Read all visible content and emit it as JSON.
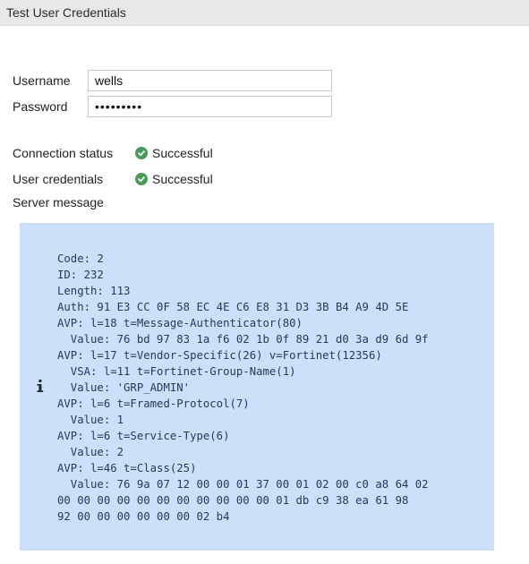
{
  "header": {
    "title": "Test User Credentials"
  },
  "form": {
    "username_label": "Username",
    "username_value": "wells",
    "password_label": "Password",
    "password_value": "•••••••••"
  },
  "status": {
    "connection_label": "Connection status",
    "connection_value": "Successful",
    "credentials_label": "User credentials",
    "credentials_value": "Successful",
    "server_message_label": "Server message"
  },
  "server_message": {
    "text": "Code: 2\nID: 232\nLength: 113\nAuth: 91 E3 CC 0F 58 EC 4E C6 E8 31 D3 3B B4 A9 4D 5E\nAVP: l=18 t=Message-Authenticator(80)\n  Value: 76 bd 97 83 1a f6 02 1b 0f 89 21 d0 3a d9 6d 9f\nAVP: l=17 t=Vendor-Specific(26) v=Fortinet(12356)\n  VSA: l=11 t=Fortinet-Group-Name(1)\n  Value: 'GRP_ADMIN'\nAVP: l=6 t=Framed-Protocol(7)\n  Value: 1\nAVP: l=6 t=Service-Type(6)\n  Value: 2\nAVP: l=46 t=Class(25)\n  Value: 76 9a 07 12 00 00 01 37 00 01 02 00 c0 a8 64 02\n00 00 00 00 00 00 00 00 00 00 00 01 db c9 38 ea 61 98\n92 00 00 00 00 00 00 02 b4"
  },
  "icons": {
    "status_check": "check-circle-icon",
    "info": "info-icon"
  },
  "colors": {
    "success": "#4a9a5a",
    "message_bg": "#cce0fa",
    "message_text": "#233a5c"
  }
}
